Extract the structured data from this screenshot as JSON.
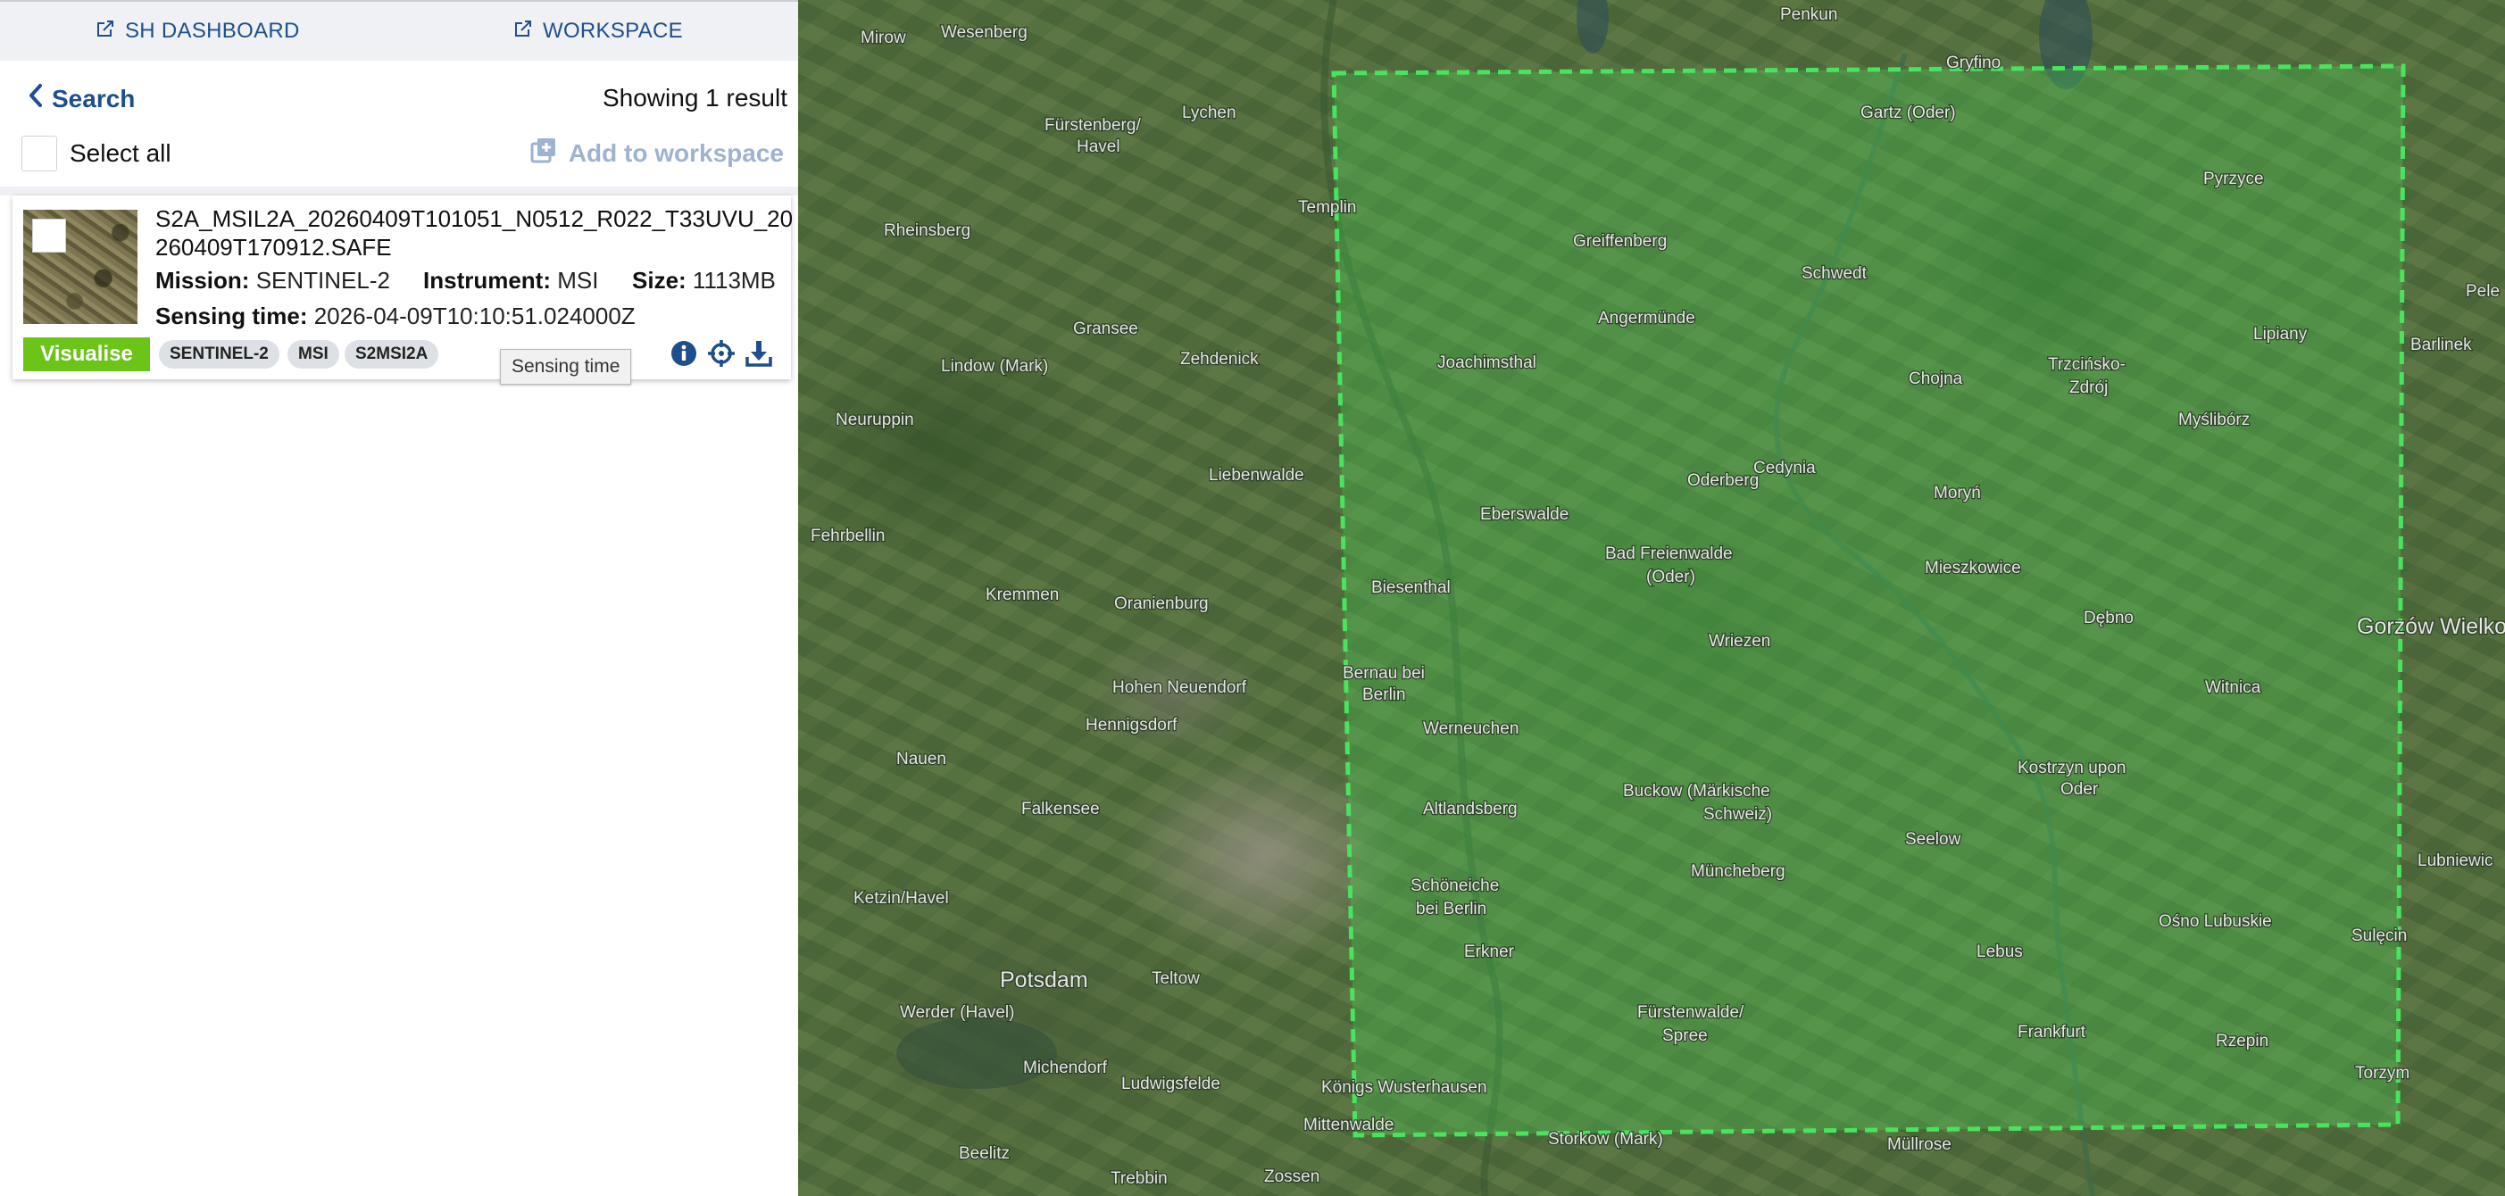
{
  "topbar": {
    "dashboard_label": "SH DASHBOARD",
    "workspace_label": "WORKSPACE"
  },
  "results": {
    "back_label": "Search",
    "showing_text": "Showing 1 result",
    "select_all_label": "Select all",
    "add_to_workspace_label": "Add to workspace"
  },
  "result": {
    "filename": "S2A_MSIL2A_20260409T101051_N0512_R022_T33UVU_20260409T170912.SAFE",
    "mission_label": "Mission:",
    "mission_value": "SENTINEL-2",
    "instrument_label": "Instrument:",
    "instrument_value": "MSI",
    "size_label": "Size:",
    "size_value": "1113MB",
    "sensing_label": "Sensing time:",
    "sensing_value": "2026-04-09T10:10:51.024000Z",
    "visualise_label": "Visualise",
    "tags": [
      "SENTINEL-2",
      "MSI",
      "S2MSI2A"
    ],
    "tooltip": "Sensing time"
  },
  "icons": {
    "external_link": "external-link-icon",
    "chevron_left": "chevron-left-icon",
    "add_layers": "add-layers-icon",
    "info": "info-icon",
    "crosshair": "crosshair-icon",
    "download": "download-icon"
  },
  "colors": {
    "link_blue": "#1e4f8c",
    "visualise_green": "#6cc419",
    "footprint_green": "#49e35f",
    "disabled_blue": "#9db3d0"
  },
  "map": {
    "places": [
      "Penkun",
      "Mirow",
      "Wesenberg",
      "Gryfino",
      "Gartz (Oder)",
      "Fürstenberg/",
      "Havel",
      "Lychen",
      "Pyrzyce",
      "Templin",
      "Rheinsberg",
      "Greiffenberg",
      "Schwedt",
      "Pele",
      "Angermünde",
      "Lipiany",
      "Barlinek",
      "Gransee",
      "Zehdenick",
      "Lindow (Mark)",
      "Joachimsthal",
      "Chojna",
      "Trzcińsko-",
      "Zdrój",
      "Myślibórz",
      "Neuruppin",
      "Cedynia",
      "Liebenwalde",
      "Oderberg",
      "Moryń",
      "Eberswalde",
      "Fehrbellin",
      "Bad Freienwalde",
      "(Oder)",
      "Mieszkowice",
      "Kremmen",
      "Oranienburg",
      "Biesenthal",
      "Dębno",
      "Gorzów Wielko",
      "Wriezen",
      "Bernau bei",
      "Berlin",
      "Hohen Neuendorf",
      "Witnica",
      "Hennigsdorf",
      "Werneuchen",
      "Nauen",
      "Kostrzyn upon",
      "Oder",
      "Buckow (Märkische",
      "Schweiz)",
      "Falkensee",
      "Altlandsberg",
      "Seelow",
      "Lubniewic",
      "Müncheberg",
      "Ketzin/Havel",
      "Schöneiche",
      "bei Berlin",
      "Ośno Lubuskie",
      "Sulęcin",
      "Erkner",
      "Lebus",
      "Potsdam",
      "Teltow",
      "Werder (Havel)",
      "Fürstenwalde/",
      "Spree",
      "Rzepin",
      "Frankfurt",
      "Michendorf",
      "Ludwigsfelde",
      "Torzym",
      "Königs Wusterhausen",
      "Mittenwalde",
      "Storkow (Mark)",
      "Müllrose",
      "Beelitz",
      "Trebbin",
      "Zossen"
    ]
  }
}
